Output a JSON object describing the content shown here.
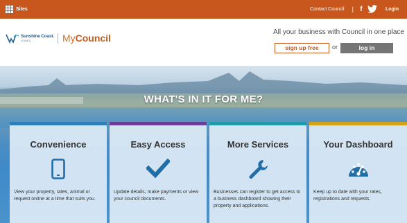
{
  "topbar": {
    "sites_label": "Sites",
    "contact_label": "Contact Council",
    "facebook_label": "f",
    "login_label": "Login",
    "background": "#c8571e"
  },
  "header": {
    "logo_text": "Sunshine Coast.",
    "logo_subtext": "COUNCIL",
    "brand_prefix": "My",
    "brand_suffix": "Council",
    "tagline": "All your business with Council in one place",
    "signup_label": "sign up free",
    "or_label": "or",
    "login_label": "log in"
  },
  "hero": {
    "title": "WHAT'S IN IT FOR ME?"
  },
  "cards": [
    {
      "title": "Convenience",
      "icon": "mobile-phone-icon",
      "text": "View your property, rates, animal or request online at a time that suits you.",
      "accent": "#2e7fb8"
    },
    {
      "title": "Easy Access",
      "icon": "checkmark-icon",
      "text": "Update details, make payments or view your council documents.",
      "accent": "#6a3f9a"
    },
    {
      "title": "More Services",
      "icon": "wrench-icon",
      "text": "Businesses can register to get access to a business dashboard showing their property and applications.",
      "accent": "#1e9aa8"
    },
    {
      "title": "Your Dashboard",
      "icon": "dashboard-gauge-icon",
      "text": "Keep up to date with your rates, registrations and requests.",
      "accent": "#d4a21a"
    }
  ],
  "colors": {
    "brand_orange": "#c8571e",
    "icon_blue": "#1f6ea8",
    "login_grey": "#757575"
  }
}
